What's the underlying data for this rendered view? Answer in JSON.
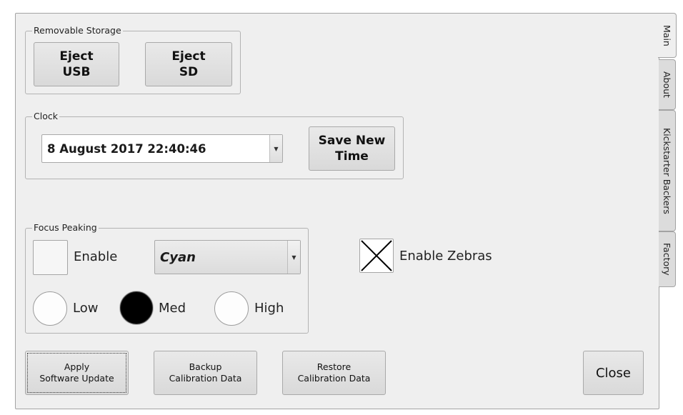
{
  "tabs": [
    {
      "label": "Main",
      "active": true
    },
    {
      "label": "About",
      "active": false
    },
    {
      "label": "Kickstarter Backers",
      "active": false
    },
    {
      "label": "Factory",
      "active": false
    }
  ],
  "removable_storage": {
    "title": "Removable Storage",
    "eject_usb": "Eject\nUSB",
    "eject_sd": "Eject\nSD"
  },
  "clock": {
    "title": "Clock",
    "datetime": "8 August 2017 22:40:46",
    "save_button": "Save New\nTime"
  },
  "focus_peaking": {
    "title": "Focus Peaking",
    "enable_label": "Enable",
    "enabled": false,
    "color": "Cyan",
    "levels": [
      {
        "label": "Low",
        "selected": false
      },
      {
        "label": "Med",
        "selected": true
      },
      {
        "label": "High",
        "selected": false
      }
    ]
  },
  "zebras": {
    "label": "Enable Zebras",
    "checked": true
  },
  "bottom_buttons": {
    "apply_update": "Apply\nSoftware Update",
    "backup_calibration": "Backup\nCalibration Data",
    "restore_calibration": "Restore\nCalibration Data",
    "close": "Close"
  }
}
